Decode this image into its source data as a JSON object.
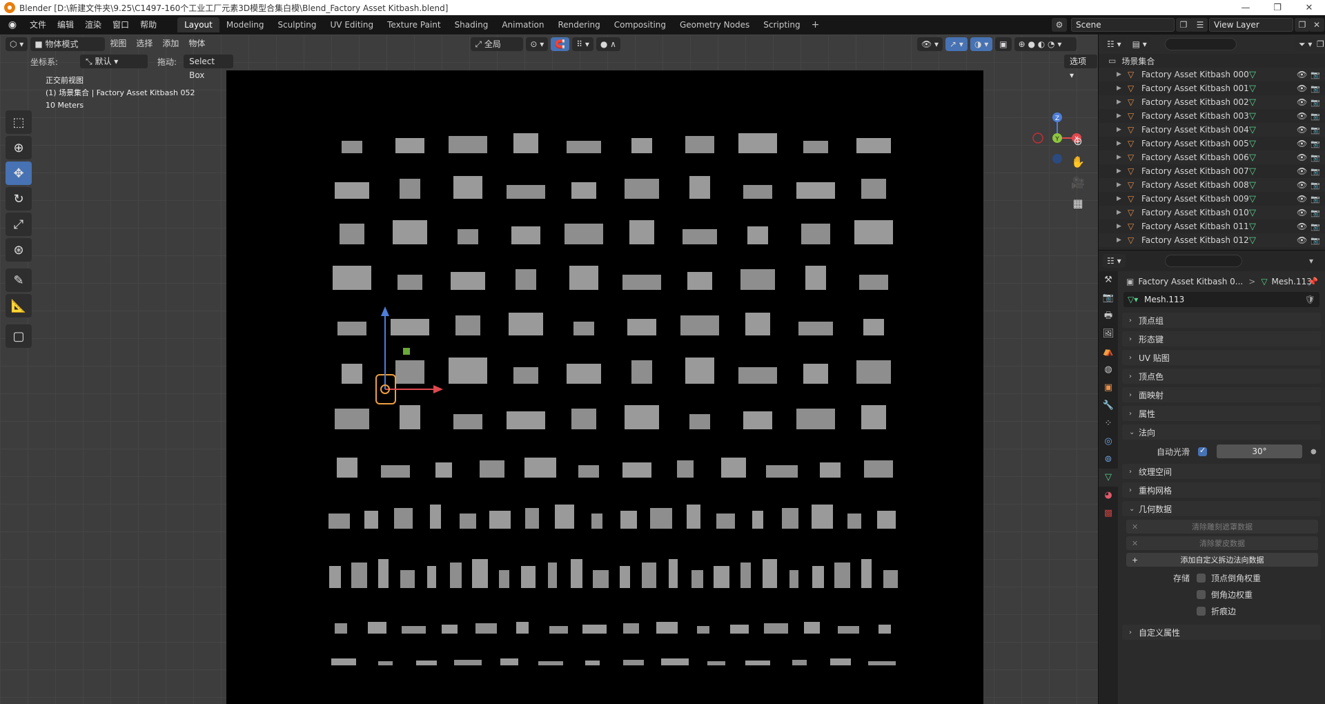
{
  "window": {
    "title": "Blender [D:\\新建文件夹\\9.25\\C1497-160个工业工厂元素3D模型合集白模\\Blend_Factory Asset Kitbash.blend]",
    "controls": [
      "—",
      "❐",
      "✕"
    ]
  },
  "topbar": {
    "menus": [
      "文件",
      "编辑",
      "渲染",
      "窗口",
      "帮助"
    ],
    "workspaces": [
      "Layout",
      "Modeling",
      "Sculpting",
      "UV Editing",
      "Texture Paint",
      "Shading",
      "Animation",
      "Rendering",
      "Compositing",
      "Geometry Nodes",
      "Scripting"
    ],
    "active_workspace": "Layout",
    "add_label": "+",
    "scene": "Scene",
    "view_layer": "View Layer"
  },
  "viewport": {
    "mode": "物体模式",
    "menus": [
      "视图",
      "选择",
      "添加",
      "物体"
    ],
    "transform_orientation": "全局",
    "coord_label": "坐标系:",
    "coord_value": "默认",
    "drag_label": "拖动:",
    "drag_value": "Select Box",
    "options": "选项",
    "info_view": "正交前视图",
    "info_object": "(1) 场景集合 | Factory Asset Kitbash 052",
    "info_scale": "10 Meters",
    "gizmo": {
      "z": "Z",
      "y": "Y",
      "x": "X"
    }
  },
  "outliner": {
    "collection": "场景集合",
    "items": [
      "Factory Asset Kitbash 000",
      "Factory Asset Kitbash 001",
      "Factory Asset Kitbash 002",
      "Factory Asset Kitbash 003",
      "Factory Asset Kitbash 004",
      "Factory Asset Kitbash 005",
      "Factory Asset Kitbash 006",
      "Factory Asset Kitbash 007",
      "Factory Asset Kitbash 008",
      "Factory Asset Kitbash 009",
      "Factory Asset Kitbash 010",
      "Factory Asset Kitbash 011",
      "Factory Asset Kitbash 012"
    ]
  },
  "properties": {
    "object_crumb": "Factory Asset Kitbash 0...",
    "crumb_sep": ">",
    "mesh_crumb": "Mesh.113",
    "mesh_name": "Mesh.113",
    "panels": {
      "vertex_groups": "顶点组",
      "shape_keys": "形态键",
      "uv_maps": "UV 贴图",
      "color_attributes": "顶点色",
      "face_maps": "面映射",
      "attributes": "属性",
      "normals": "法向",
      "texture_space": "纹理空间",
      "remesh": "重构网格",
      "geometry_data": "几何数据",
      "custom_props": "自定义属性"
    },
    "auto_smooth_label": "自动光滑",
    "auto_smooth_angle": "30°",
    "btn_clear_sculpt_mask": "清除雕刻遮罩数据",
    "btn_clear_skin": "清除蒙皮数据",
    "btn_add_custom_split_normals": "添加自定义拆边法向数据",
    "store_label": "存储",
    "chk_vertex_bevel": "顶点倒角权重",
    "chk_edge_bevel": "倒角边权重",
    "chk_crease": "折痕边"
  }
}
